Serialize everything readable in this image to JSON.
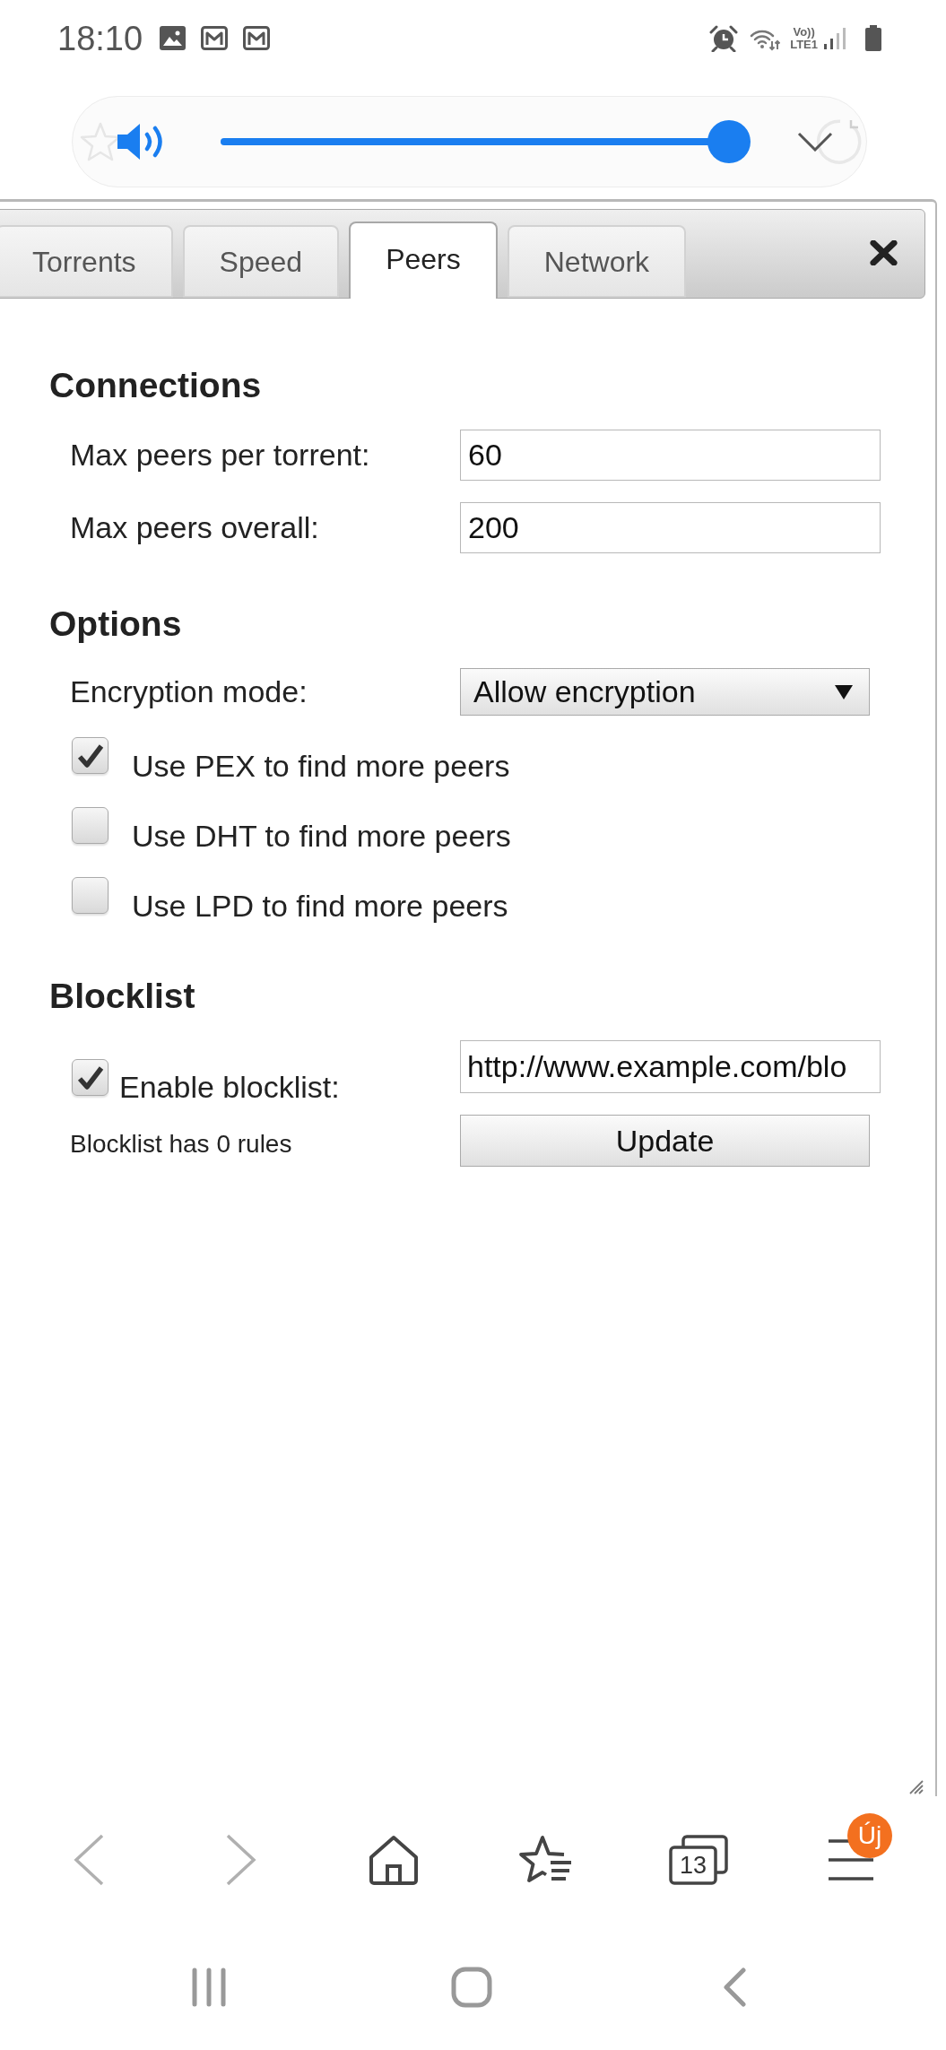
{
  "status_bar": {
    "time": "18:10",
    "volte": "Vo))",
    "network": "LTE1"
  },
  "volume": {
    "level": 1
  },
  "dialog": {
    "tabs": [
      {
        "label": "Torrents",
        "selected": false
      },
      {
        "label": "Speed",
        "selected": false
      },
      {
        "label": "Peers",
        "selected": true
      },
      {
        "label": "Network",
        "selected": false
      }
    ],
    "sections": [
      {
        "title": "Connections",
        "rows": [
          {
            "kind": "number",
            "label": "Max peers per torrent:",
            "value": "60"
          },
          {
            "kind": "number",
            "label": "Max peers overall:",
            "value": "200"
          }
        ]
      },
      {
        "title": "Options",
        "rows": [
          {
            "kind": "select",
            "label": "Encryption mode:",
            "value": "Allow encryption"
          },
          {
            "kind": "checkbox",
            "label": "Use PEX to find more peers",
            "checked": true
          },
          {
            "kind": "checkbox",
            "label": "Use DHT to find more peers",
            "checked": false
          },
          {
            "kind": "checkbox",
            "label": "Use LPD to find more peers",
            "checked": false
          }
        ]
      },
      {
        "title": "Blocklist",
        "rows": [
          {
            "kind": "blocklist",
            "label": "Enable blocklist:",
            "checked": true,
            "value": "http://www.example.com/blo",
            "status": "Blocklist has 0 rules",
            "button": "Update"
          }
        ]
      }
    ]
  },
  "bottom_toolbar": {
    "back": {
      "disabled": true
    },
    "forward": {
      "disabled": true
    },
    "tab_count": "13",
    "menu_badge": "Új"
  }
}
